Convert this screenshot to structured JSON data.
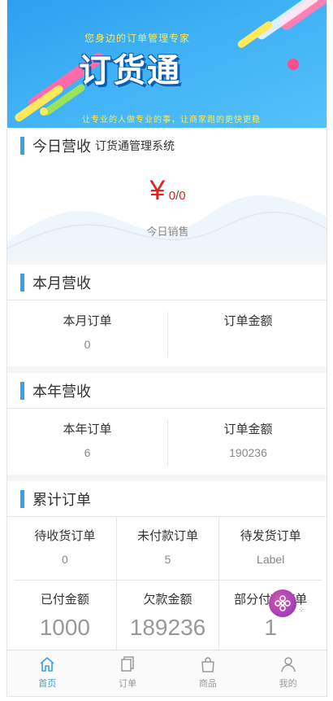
{
  "banner": {
    "tagline": "您身边的订单管理专家",
    "brand": "订货通",
    "slogan": "让专业的人做专业的事，让商家跑的更快更稳"
  },
  "today": {
    "title": "今日营收",
    "subtitle": "订货通管理系统",
    "currency": "¥",
    "amount": "0",
    "slash": "/",
    "amount2": "0",
    "caption": "今日销售"
  },
  "month": {
    "title": "本月营收",
    "orders_label": "本月订单",
    "orders_value": "0",
    "amount_label": "订单金额",
    "amount_value": ""
  },
  "year": {
    "title": "本年营收",
    "orders_label": "本年订单",
    "orders_value": "6",
    "amount_label": "订单金额",
    "amount_value": "190236"
  },
  "total": {
    "title": "累计订单",
    "row1": [
      {
        "label": "待收货订单",
        "value": "0"
      },
      {
        "label": "未付款订单",
        "value": "5"
      },
      {
        "label": "待发货订单",
        "value": "Label"
      }
    ],
    "row2": [
      {
        "label": "已付金额",
        "value": "1000"
      },
      {
        "label": "欠款金额",
        "value": "189236"
      },
      {
        "label": "部分付款订单",
        "value": "1"
      }
    ]
  },
  "tabs": [
    {
      "label": "首页",
      "icon": "home-icon",
      "active": true
    },
    {
      "label": "订单",
      "icon": "orders-icon",
      "active": false
    },
    {
      "label": "商品",
      "icon": "bag-icon",
      "active": false
    },
    {
      "label": "我的",
      "icon": "user-icon",
      "active": false
    }
  ],
  "colors": {
    "accent": "#3aa0e8",
    "money": "#e02020"
  }
}
